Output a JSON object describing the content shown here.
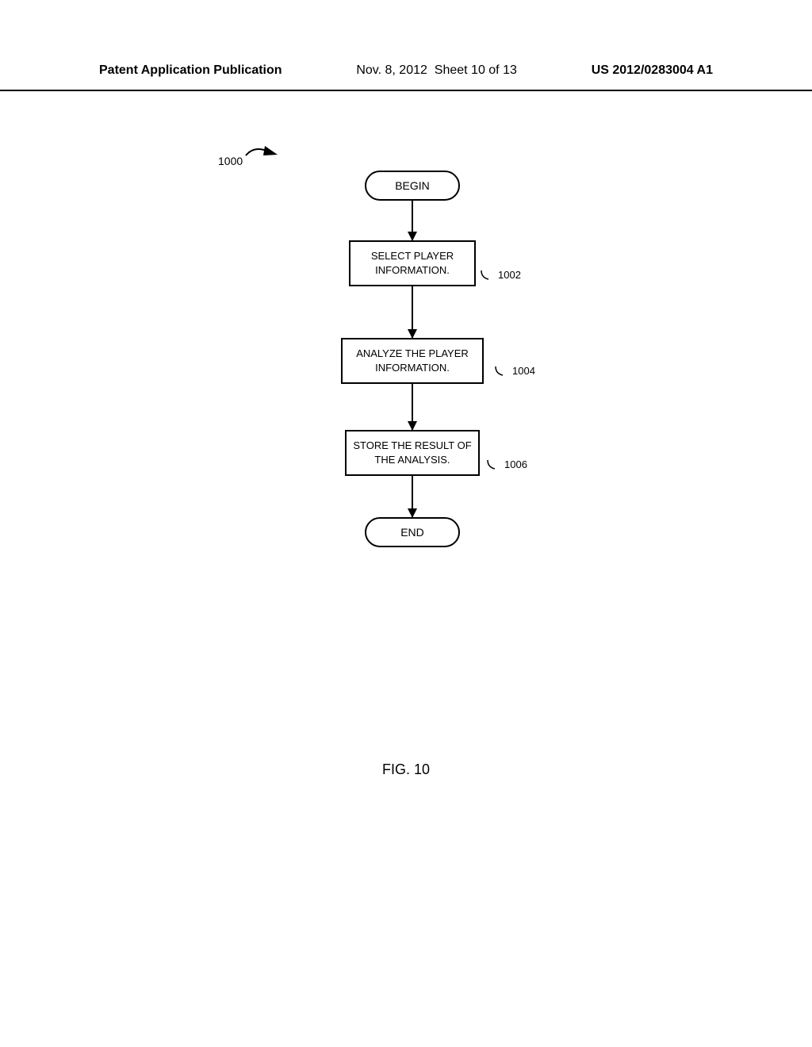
{
  "header": {
    "left": "Patent Application Publication",
    "date": "Nov. 8, 2012",
    "sheet": "Sheet 10 of 13",
    "pub_number": "US 2012/0283004 A1"
  },
  "flowchart": {
    "ref_main": "1000",
    "begin": "BEGIN",
    "end": "END",
    "steps": [
      {
        "text": "SELECT PLAYER INFORMATION.",
        "ref": "1002"
      },
      {
        "text": "ANALYZE THE PLAYER INFORMATION.",
        "ref": "1004"
      },
      {
        "text": "STORE THE RESULT OF THE ANALYSIS.",
        "ref": "1006"
      }
    ]
  },
  "figure_label": "FIG. 10"
}
